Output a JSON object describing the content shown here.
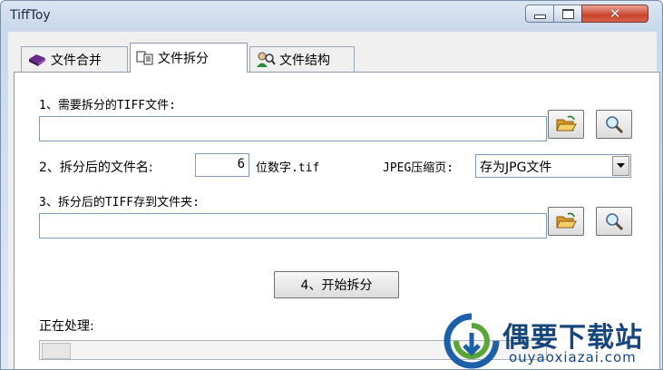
{
  "window": {
    "title": "TiffToy",
    "close_symbol": "✕"
  },
  "tabs": [
    {
      "label": "文件合并",
      "icon": "book-icon"
    },
    {
      "label": "文件拆分",
      "icon": "split-pages-icon",
      "active": true
    },
    {
      "label": "文件结构",
      "icon": "search-user-icon"
    }
  ],
  "split": {
    "source_label": "1、需要拆分的TIFF文件:",
    "source_value": "",
    "filename_label": "2、拆分后的文件名:",
    "digits_value": "6",
    "digits_suffix": "位数字.tif",
    "jpeg_label": "JPEG压缩页:",
    "jpeg_selected": "存为JPG文件",
    "dest_label": "3、拆分后的TIFF存到文件夹:",
    "dest_value": "",
    "start_label": "4、开始拆分",
    "processing_label": "正在处理:"
  },
  "watermark": {
    "name": "偶要下载站",
    "url": "ouyaoxiazai.com"
  },
  "colors": {
    "folder": "#e8b84a",
    "watermark": "#16467b",
    "close": "#c8432c"
  }
}
